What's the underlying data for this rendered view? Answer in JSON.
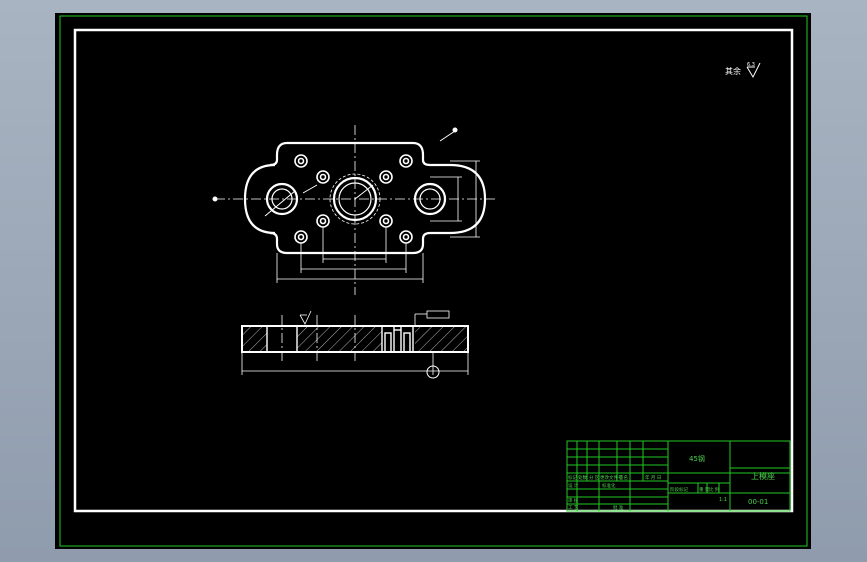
{
  "colors": {
    "background": "#000000",
    "outer_border": "#22c722",
    "drawing_lines": "#ffffff",
    "title_block_lines": "#22c722",
    "title_block_text": "#4cd14c"
  },
  "roughness_note": {
    "label": "其余",
    "value": "6.3"
  },
  "title_block": {
    "material": "45钢",
    "part_name": "上模座",
    "drawing_number": "00-01",
    "scale": "1:1",
    "grid_labels": {
      "mark": "标记",
      "count": "处数",
      "zone": "分 区",
      "change_doc": "更改文件号",
      "signature": "签名",
      "date": "年 月 日",
      "standardization": "标准化",
      "stage_mark": "阶段标记",
      "weight": "重 量",
      "ratio": "比 例",
      "approve": "批 准"
    },
    "left_labels": [
      "设 计",
      "审 核",
      "工 艺"
    ]
  }
}
